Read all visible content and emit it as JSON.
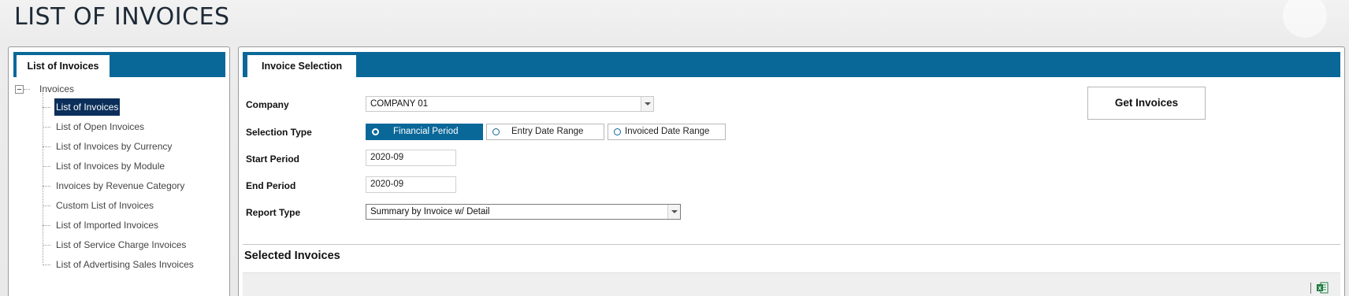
{
  "page": {
    "title": "LIST OF INVOICES"
  },
  "left_panel": {
    "tab_label": "List of Invoices",
    "tree": {
      "root_label": "Invoices",
      "items": [
        {
          "label": "List of Invoices",
          "selected": true
        },
        {
          "label": "List of Open Invoices"
        },
        {
          "label": "List of Invoices by Currency"
        },
        {
          "label": "List of Invoices by Module"
        },
        {
          "label": "Invoices by Revenue Category"
        },
        {
          "label": "Custom List of Invoices"
        },
        {
          "label": "List of Imported Invoices"
        },
        {
          "label": "List of Service Charge Invoices"
        },
        {
          "label": "List of Advertising Sales Invoices"
        }
      ]
    }
  },
  "main_panel": {
    "tab_label": "Invoice Selection",
    "form": {
      "company_label": "Company",
      "company_value": "COMPANY 01",
      "selection_type_label": "Selection Type",
      "selection_options": [
        {
          "label": "Financial Period",
          "selected": true
        },
        {
          "label": "Entry Date Range",
          "selected": false
        },
        {
          "label": "Invoiced Date Range",
          "selected": false
        }
      ],
      "start_period_label": "Start Period",
      "start_period_value": "2020-09",
      "end_period_label": "End Period",
      "end_period_value": "2020-09",
      "report_type_label": "Report Type",
      "report_type_value": "Summary by Invoice w/ Detail"
    },
    "get_invoices_label": "Get Invoices",
    "selected_section_title": "Selected Invoices",
    "toolbar": {
      "export_icon": "excel-icon"
    }
  },
  "colors": {
    "accent": "#0a6899",
    "selected_tree": "#0b2f5a",
    "excel_green": "#1d7a3e"
  }
}
